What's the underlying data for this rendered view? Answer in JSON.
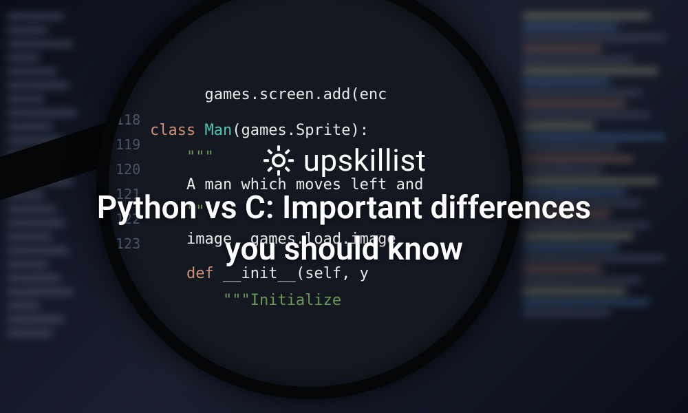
{
  "logo": {
    "brand_name": "upskillist"
  },
  "title": {
    "line1": "Python vs C: Important differences",
    "line2": "you should know"
  },
  "code": {
    "line_top": "games.screen.add(enc",
    "line_numbers": [
      "118",
      "119",
      "120",
      "121",
      "122",
      "123"
    ],
    "class_keyword": "class",
    "class_name": "Man",
    "class_parent_open": "(games",
    "class_parent_dot": ".",
    "class_parent_attr": "Sprite",
    "class_parent_close": "):",
    "docstring_open": "\"\"\"",
    "docstring_text": "A man which moves left and",
    "docstring_close": "\"\"\"",
    "image_var": "image",
    "image_assign": "  games.load.image",
    "def_keyword": "def",
    "init_name": "__init__",
    "init_params": "(self, y",
    "init_docstring": "\"\"\"Initialize"
  }
}
